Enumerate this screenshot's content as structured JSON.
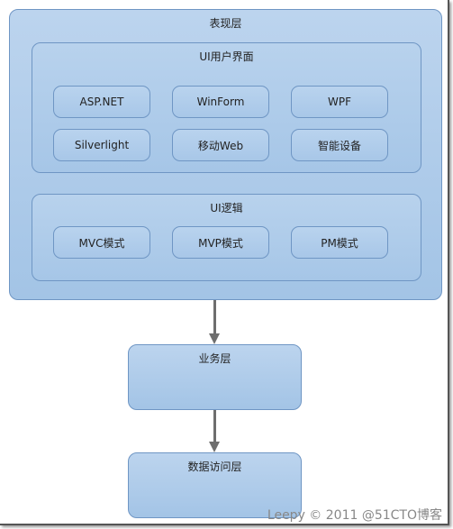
{
  "presentation_layer": {
    "title": "表现层",
    "ui_group": {
      "title": "UI用户界面",
      "items": [
        "ASP.NET",
        "WinForm",
        "WPF",
        "Silverlight",
        "移动Web",
        "智能设备"
      ]
    },
    "logic_group": {
      "title": "UI逻辑",
      "items": [
        "MVC模式",
        "MVP模式",
        "PM模式"
      ]
    }
  },
  "business_layer": {
    "title": "业务层"
  },
  "data_access_layer": {
    "title": "数据访问层"
  },
  "watermark": "Leepy © 2011  @51CTO博客"
}
